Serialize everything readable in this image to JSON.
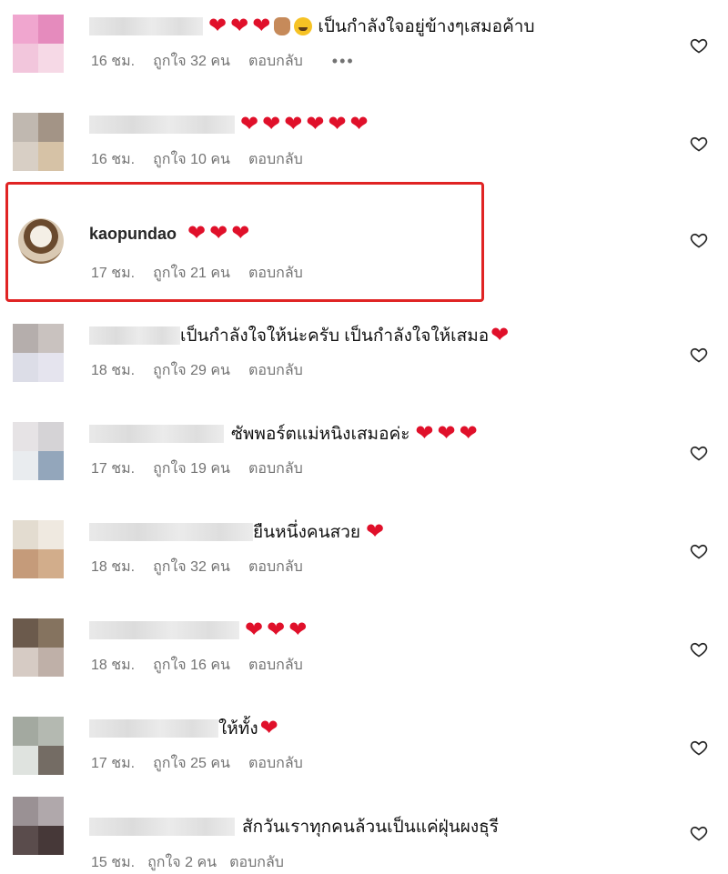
{
  "comments": [
    {
      "username": "",
      "text": "เป็นกำลังใจอยู่ข้างๆเสมอค้าบ",
      "time": "16 ชม.",
      "likes": "ถูกใจ 32 คน",
      "reply": "ตอบกลับ",
      "more": "•••",
      "hearts": 3
    },
    {
      "username": "",
      "text": "",
      "time": "16 ชม.",
      "likes": "ถูกใจ 10 คน",
      "reply": "ตอบกลับ",
      "hearts": 6
    },
    {
      "username": "kaopundao",
      "text": "",
      "time": "17 ชม.",
      "likes": "ถูกใจ 21 คน",
      "reply": "ตอบกลับ",
      "hearts": 3
    },
    {
      "username": "",
      "text": "เป็นกำลังใจให้น่ะครับ เป็นกำลังใจให้เสมอ",
      "time": "18 ชม.",
      "likes": "ถูกใจ 29 คน",
      "reply": "ตอบกลับ",
      "hearts": 1
    },
    {
      "username": "",
      "text": "ซัพพอร์ตแม่หนิงเสมอค่ะ",
      "time": "17 ชม.",
      "likes": "ถูกใจ 19 คน",
      "reply": "ตอบกลับ",
      "hearts": 3
    },
    {
      "username": "",
      "text": "ยืนหนึ่งคนสวย",
      "time": "18 ชม.",
      "likes": "ถูกใจ 32 คน",
      "reply": "ตอบกลับ",
      "hearts": 1
    },
    {
      "username": "",
      "text": "",
      "time": "18 ชม.",
      "likes": "ถูกใจ 16 คน",
      "reply": "ตอบกลับ",
      "hearts": 3
    },
    {
      "username": "",
      "text": "ให้ทั้ง",
      "time": "17 ชม.",
      "likes": "ถูกใจ 25 คน",
      "reply": "ตอบกลับ",
      "hearts": 1
    },
    {
      "username": "",
      "text": "สักวันเราทุกคนล้วนเป็นแค่ฝุ่นผงธุรี",
      "time": "15 ชม.",
      "likes": "ถูกใจ 2 คน",
      "reply": "ตอบกลับ",
      "hearts": 0
    }
  ],
  "icons": {
    "like": "heart-outline-icon",
    "emoji_heart": "red-heart",
    "emoji_hand": "hand-icon",
    "emoji_face": "grinning-face"
  },
  "colors": {
    "heart": "#e0102a",
    "highlight": "#e02424",
    "meta": "#737373"
  }
}
